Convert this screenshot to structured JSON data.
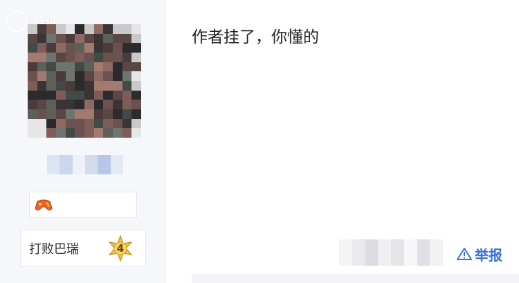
{
  "watermark": {
    "text": "游侠"
  },
  "user": {
    "badge_icon": "gamepad-icon",
    "achievement": {
      "label": "打败巴瑞",
      "level": "4"
    }
  },
  "comment": {
    "text": "作者挂了，你懂的"
  },
  "actions": {
    "report_label": "举报",
    "report_icon": "warning-triangle-icon"
  },
  "colors": {
    "accent": "#3b6fd6",
    "panel_bg": "#f5f7fb"
  }
}
